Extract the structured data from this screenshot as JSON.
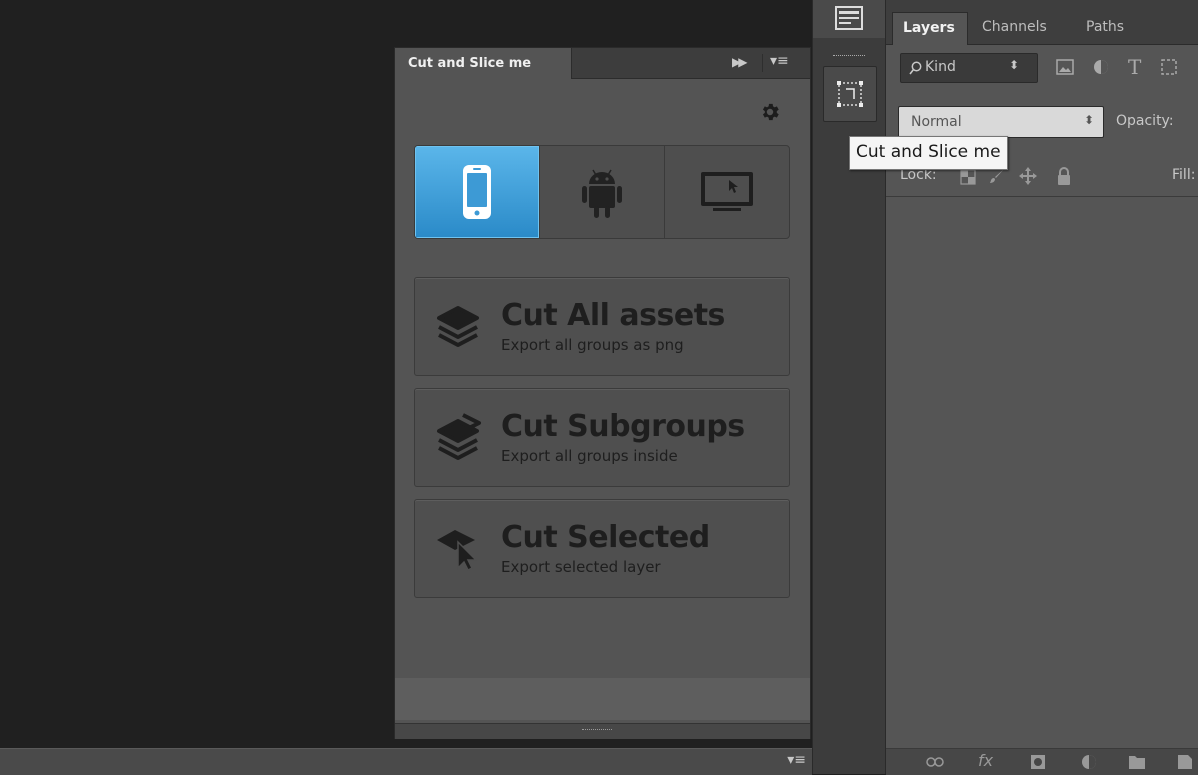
{
  "plugin_panel": {
    "tab_title": "Cut and Slice me",
    "collapse_glyph": "▶▶",
    "menu_glyph": "▾≡",
    "settings_icon": "gear-icon",
    "devices": [
      {
        "id": "ios",
        "icon": "iphone-icon",
        "selected": true
      },
      {
        "id": "android",
        "icon": "android-icon",
        "selected": false
      },
      {
        "id": "desktop",
        "icon": "desktop-monitor-icon",
        "selected": false
      }
    ],
    "actions": [
      {
        "title": "Cut All assets",
        "subtitle": "Export all groups as png",
        "icon": "layers-stack-icon"
      },
      {
        "title": "Cut Subgroups",
        "subtitle": "Export all groups inside",
        "icon": "layers-fanned-icon"
      },
      {
        "title": "Cut Selected",
        "subtitle": "Export selected layer",
        "icon": "layer-cursor-icon"
      }
    ],
    "accent_color": "#3a9ad9"
  },
  "tooltip": {
    "text": "Cut and Slice me"
  },
  "bottom_bar": {
    "menu_glyph": "▾≡"
  },
  "layers_panel": {
    "tabs": [
      {
        "label": "Layers",
        "active": true
      },
      {
        "label": "Channels",
        "active": false
      },
      {
        "label": "Paths",
        "active": false
      }
    ],
    "filter": {
      "kind_label": "Kind",
      "arrow": "⬍",
      "type_glyph": "T"
    },
    "blend": {
      "mode": "Normal",
      "arrow": "⬍",
      "opacity_label": "Opacity:"
    },
    "lock": {
      "label": "Lock:",
      "fill_label": "Fill:"
    },
    "bottom_icons": [
      "link-icon",
      "fx-icon",
      "mask-icon",
      "adjustment-icon",
      "folder-icon",
      "new-layer-icon"
    ]
  }
}
